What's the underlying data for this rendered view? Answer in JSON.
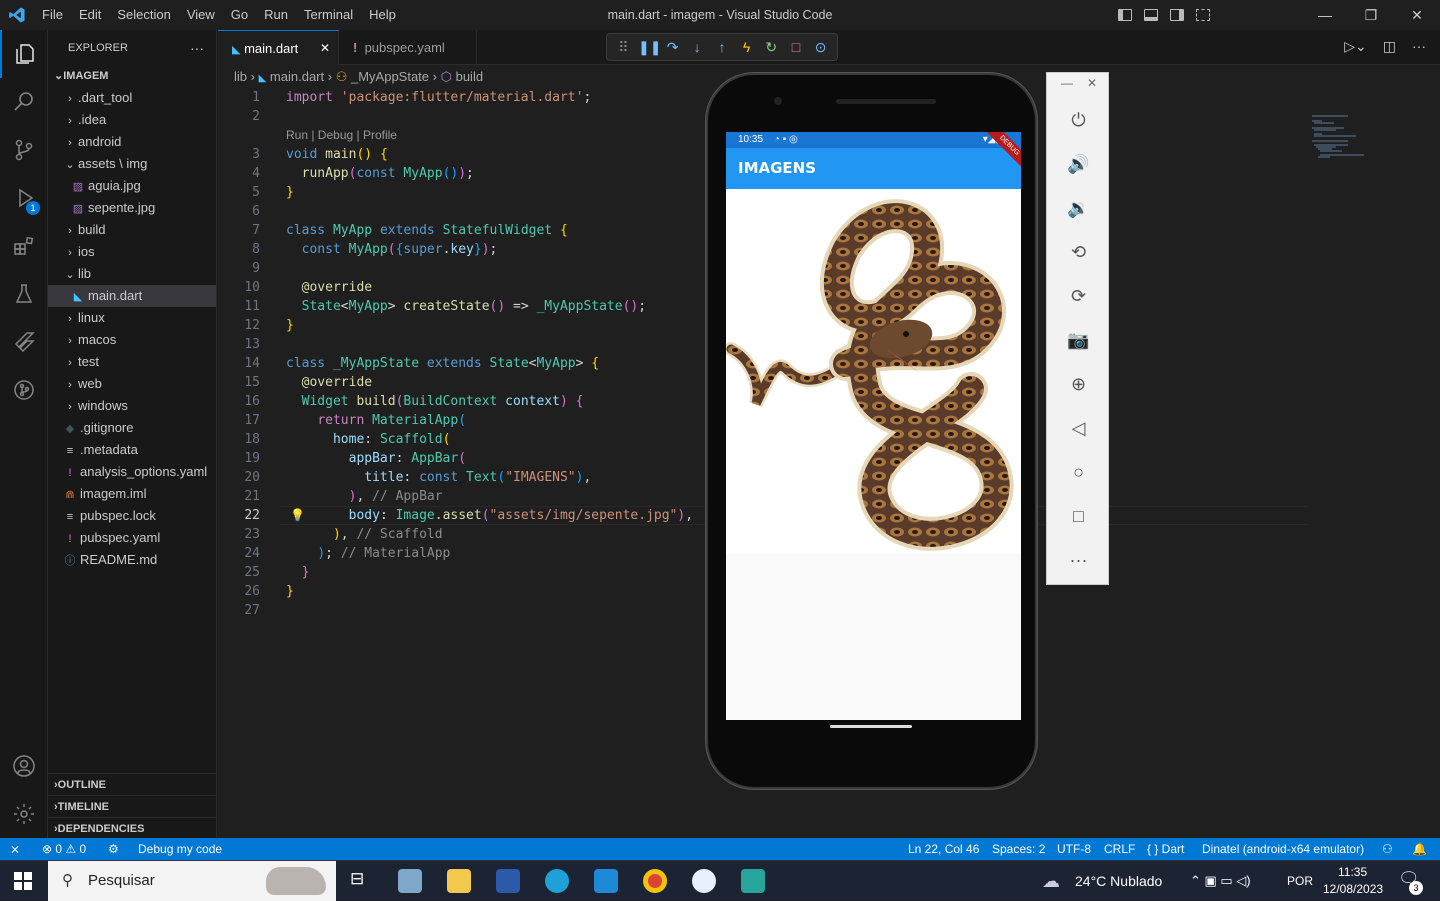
{
  "window": {
    "title": "main.dart - imagem - Visual Studio Code",
    "menu": [
      "File",
      "Edit",
      "Selection",
      "View",
      "Go",
      "Run",
      "Terminal",
      "Help"
    ]
  },
  "activity_bar": {
    "debug_badge": "1"
  },
  "explorer": {
    "header": "EXPLORER",
    "more": "···",
    "root": "IMAGEM",
    "items": [
      {
        "label": ".dart_tool",
        "type": "folder",
        "indent": 1,
        "icon": "chevron-right-icon"
      },
      {
        "label": ".idea",
        "type": "folder",
        "indent": 1,
        "icon": "chevron-right-icon"
      },
      {
        "label": "android",
        "type": "folder",
        "indent": 1,
        "icon": "chevron-right-icon"
      },
      {
        "label": "assets \\ img",
        "type": "folder-open",
        "indent": 1,
        "icon": "chevron-down-icon"
      },
      {
        "label": "aguia.jpg",
        "type": "image",
        "indent": 2,
        "icon": "image-file-icon"
      },
      {
        "label": "sepente.jpg",
        "type": "image",
        "indent": 2,
        "icon": "image-file-icon"
      },
      {
        "label": "build",
        "type": "folder",
        "indent": 1,
        "icon": "chevron-right-icon"
      },
      {
        "label": "ios",
        "type": "folder",
        "indent": 1,
        "icon": "chevron-right-icon"
      },
      {
        "label": "lib",
        "type": "folder-open",
        "indent": 1,
        "icon": "chevron-down-icon"
      },
      {
        "label": "main.dart",
        "type": "dart",
        "indent": 2,
        "icon": "dart-file-icon",
        "selected": true
      },
      {
        "label": "linux",
        "type": "folder",
        "indent": 1,
        "icon": "chevron-right-icon"
      },
      {
        "label": "macos",
        "type": "folder",
        "indent": 1,
        "icon": "chevron-right-icon"
      },
      {
        "label": "test",
        "type": "folder",
        "indent": 1,
        "icon": "chevron-right-icon"
      },
      {
        "label": "web",
        "type": "folder",
        "indent": 1,
        "icon": "chevron-right-icon"
      },
      {
        "label": "windows",
        "type": "folder",
        "indent": 1,
        "icon": "chevron-right-icon"
      },
      {
        "label": ".gitignore",
        "type": "git",
        "indent": 1,
        "icon": "git-file-icon"
      },
      {
        "label": ".metadata",
        "type": "text",
        "indent": 1,
        "icon": "lines-file-icon"
      },
      {
        "label": "analysis_options.yaml",
        "type": "yaml",
        "indent": 1,
        "icon": "yaml-file-icon"
      },
      {
        "label": "imagem.iml",
        "type": "rss",
        "indent": 1,
        "icon": "xml-file-icon"
      },
      {
        "label": "pubspec.lock",
        "type": "text",
        "indent": 1,
        "icon": "lines-file-icon"
      },
      {
        "label": "pubspec.yaml",
        "type": "yaml",
        "indent": 1,
        "icon": "yaml-file-icon"
      },
      {
        "label": "README.md",
        "type": "info",
        "indent": 1,
        "icon": "info-file-icon"
      }
    ],
    "sections": [
      "OUTLINE",
      "TIMELINE",
      "DEPENDENCIES"
    ]
  },
  "tabs": [
    {
      "label": "main.dart",
      "active": true,
      "close": "✕"
    },
    {
      "label": "pubspec.yaml",
      "active": false
    }
  ],
  "breadcrumb": {
    "parts": [
      "lib",
      "main.dart",
      "_MyAppState",
      "build"
    ]
  },
  "code_lens": "Run | Debug | Profile",
  "current_line": "22",
  "code_lines": [
    {
      "n": "1",
      "html": "<span class='p'>import</span> <span class='s'>'package:flutter/material.dart'</span><span class='pl'>;</span>"
    },
    {
      "n": "2",
      "html": ""
    },
    {
      "n": "3",
      "html": "<span class='k'>void</span> <span class='f'>main</span><span class='y'>()</span> <span class='y'>{</span>",
      "lens": true
    },
    {
      "n": "4",
      "html": "  <span class='f'>runApp</span><span class='pu'>(</span><span class='k'>const</span> <span class='c'>MyApp</span><span class='b'>()</span><span class='pu'>)</span><span class='pl'>;</span>"
    },
    {
      "n": "5",
      "html": "<span class='y'>}</span>"
    },
    {
      "n": "6",
      "html": ""
    },
    {
      "n": "7",
      "html": "<span class='k'>class</span> <span class='c'>MyApp</span> <span class='k'>extends</span> <span class='c'>StatefulWidget</span> <span class='y'>{</span>"
    },
    {
      "n": "8",
      "html": "  <span class='k'>const</span> <span class='c'>MyApp</span><span class='pu'>(</span><span class='b'>{</span><span class='k'>super</span><span class='pl'>.</span><span class='v'>key</span><span class='b'>}</span><span class='pu'>)</span><span class='pl'>;</span>"
    },
    {
      "n": "9",
      "html": ""
    },
    {
      "n": "10",
      "html": "  <span class='f'>@override</span>"
    },
    {
      "n": "11",
      "html": "  <span class='c'>State</span><span class='pl'>&lt;</span><span class='c'>MyApp</span><span class='pl'>&gt;</span> <span class='f'>createState</span><span class='pu'>()</span> <span class='pl'>=&gt;</span> <span class='c'>_MyAppState</span><span class='pu'>()</span><span class='pl'>;</span>"
    },
    {
      "n": "12",
      "html": "<span class='y'>}</span>"
    },
    {
      "n": "13",
      "html": ""
    },
    {
      "n": "14",
      "html": "<span class='k'>class</span> <span class='c'>_MyAppState</span> <span class='k'>extends</span> <span class='c'>State</span><span class='pl'>&lt;</span><span class='c'>MyApp</span><span class='pl'>&gt;</span> <span class='y'>{</span>"
    },
    {
      "n": "15",
      "html": "  <span class='f'>@override</span>"
    },
    {
      "n": "16",
      "html": "  <span class='c'>Widget</span> <span class='f'>build</span><span class='pu'>(</span><span class='c'>BuildContext</span> <span class='v'>context</span><span class='pu'>)</span> <span class='pu'>{</span>"
    },
    {
      "n": "17",
      "html": "    <span class='p'>return</span> <span class='c'>MaterialApp</span><span class='b'>(</span>"
    },
    {
      "n": "18",
      "html": "      <span class='v'>home</span><span class='pl'>:</span> <span class='c'>Scaffold</span><span class='y'>(</span>"
    },
    {
      "n": "19",
      "html": "        <span class='v'>appBar</span><span class='pl'>:</span> <span class='c'>AppBar</span><span class='pu'>(</span>"
    },
    {
      "n": "20",
      "html": "          <span class='v'>title</span><span class='pl'>:</span> <span class='k'>const</span> <span class='c'>Text</span><span class='b'>(</span><span class='s'>\"IMAGENS\"</span><span class='b'>)</span><span class='pl'>,</span>"
    },
    {
      "n": "21",
      "html": "        <span class='pu'>)</span><span class='pl'>,</span> <span class='cm'>// AppBar</span>"
    },
    {
      "n": "22",
      "html": "        <span class='v'>body</span><span class='pl'>:</span> <span class='c'>Image</span><span class='pl'>.</span><span class='f'>asset</span><span class='pu'>(</span><span class='s'>\"assets/img/sepente.jpg\"</span><span class='pu'>)</span><span class='pl'>,</span>",
      "bulb": true
    },
    {
      "n": "23",
      "html": "      <span class='y'>)</span><span class='pl'>,</span> <span class='cm'>// Scaffold</span>"
    },
    {
      "n": "24",
      "html": "    <span class='b'>)</span><span class='pl'>;</span> <span class='cm'>// MaterialApp</span>"
    },
    {
      "n": "25",
      "html": "  <span class='pu'>}</span>"
    },
    {
      "n": "26",
      "html": "<span class='y'>}</span>"
    },
    {
      "n": "27",
      "html": ""
    }
  ],
  "phone": {
    "time": "10:35",
    "app_title": "IMAGENS",
    "debug_banner": "DEBUG"
  },
  "statusbar": {
    "problems": "⊗ 0 ⚠ 0",
    "debug": "Debug my code",
    "position": "Ln 22, Col 46",
    "spaces": "Spaces: 2",
    "encoding": "UTF-8",
    "eol": "CRLF",
    "language": "{ } Dart",
    "device": "Dinatel (android-x64 emulator)"
  },
  "taskbar": {
    "search_placeholder": "Pesquisar",
    "weather": "24°C  Nublado",
    "lang": "POR",
    "time": "11:35",
    "date": "12/08/2023",
    "notifications": "3"
  }
}
